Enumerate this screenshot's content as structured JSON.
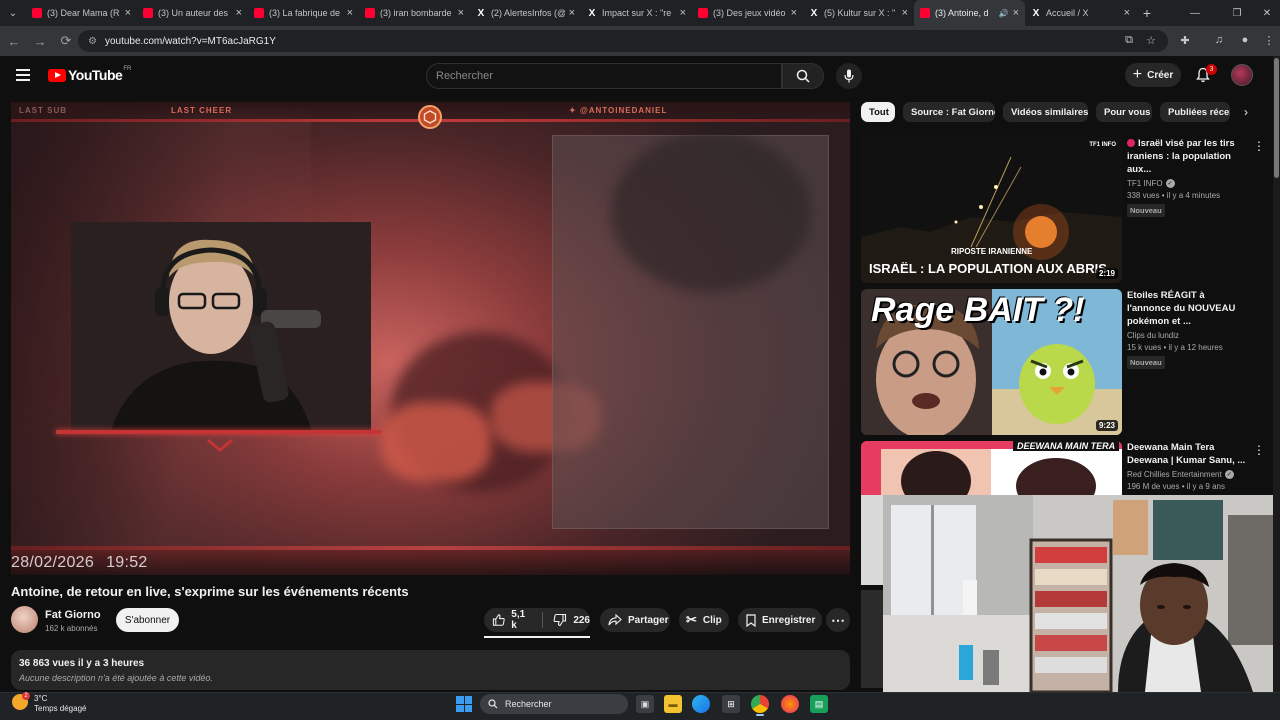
{
  "browser": {
    "tabs": [
      {
        "label": "(3) Dear Mama (R",
        "icon": "youtube-icon",
        "active": false
      },
      {
        "label": "(3) Un auteur des",
        "icon": "youtube-icon",
        "active": false
      },
      {
        "label": "(3) La fabrique de",
        "icon": "youtube-icon",
        "active": false
      },
      {
        "label": "(3) iran bombarde",
        "icon": "youtube-icon",
        "active": false
      },
      {
        "label": "(2) AlertesInfos (@",
        "icon": "x-icon",
        "active": false
      },
      {
        "label": "Impact sur X : \"re",
        "icon": "x-icon",
        "active": false
      },
      {
        "label": "(3) Des jeux vidéo",
        "icon": "youtube-icon",
        "active": false
      },
      {
        "label": "(5) Kultur sur X : \"",
        "icon": "x-icon",
        "active": false
      },
      {
        "label": "(3) Antoine, d",
        "icon": "youtube-icon",
        "active": true
      },
      {
        "label": "Accueil / X",
        "icon": "x-icon",
        "active": false
      }
    ],
    "url": "youtube.com/watch?v=MT6acJaRG1Y"
  },
  "header": {
    "logo_text": "YouTube",
    "country_code": "FR",
    "search_placeholder": "Rechercher",
    "create_label": "Créer",
    "notification_count": "3"
  },
  "player": {
    "overlay_last_sub": "LAST SUB",
    "overlay_last_cheer": "LAST CHEER",
    "overlay_handle": "@ANTOINEDANIEL",
    "date": "28/02/2026",
    "time": "19:52"
  },
  "video": {
    "title": "Antoine, de retour en live, s'exprime sur les événements récents",
    "channel_name": "Fat Giorno",
    "subscribers": "162 k abonnés",
    "subscribe_label": "S'abonner",
    "likes": "5,1 k",
    "dislikes": "226",
    "share_label": "Partager",
    "clip_label": "Clip",
    "save_label": "Enregistrer",
    "views_time": "36 863 vues  il y a 3 heures",
    "description": "Aucune description n'a été ajoutée à cette vidéo."
  },
  "chips": [
    {
      "label": "Tout",
      "active": true
    },
    {
      "label": "Source : Fat Giorno",
      "active": false
    },
    {
      "label": "Vidéos similaires",
      "active": false
    },
    {
      "label": "Pour vous",
      "active": false
    },
    {
      "label": "Publiées récemment",
      "active": false
    }
  ],
  "recommendations": [
    {
      "title": "Israël visé par les tirs iraniens : la population aux...",
      "channel": "TF1 INFO",
      "verified": true,
      "live_dot": true,
      "meta": "338 vues • il y a 4 minutes",
      "badge": "Nouveau",
      "duration": "2:19",
      "thumb_text": "ISRAËL : LA POPULATION AUX ABRIS",
      "thumb_caption": "RIPOSTE IRANIENNE",
      "thumb_brand": "TF1 INFO"
    },
    {
      "title": "Etoiles RÉAGIT à l'annonce du NOUVEAU pokémon et ...",
      "channel": "Clips du lundiz",
      "verified": false,
      "live_dot": false,
      "meta": "15 k vues • il y a 12 heures",
      "badge": "Nouveau",
      "duration": "9:23",
      "thumb_text": "Rage BAIT ?!"
    },
    {
      "title": "Deewana Main Tera Deewana | Kumar Sanu, ...",
      "channel": "Red Chillies Entertainment",
      "verified": true,
      "live_dot": false,
      "meta": "196 M de vues • il y a 9 ans",
      "badge": "",
      "duration": "",
      "thumb_text": "DEEWANA MAIN TERA"
    }
  ],
  "taskbar": {
    "temperature": "3°C",
    "weather": "Temps dégagé",
    "weather_badge": "2",
    "search_label": "Rechercher"
  },
  "colors": {
    "yt_red": "#ff0000",
    "background": "#0f0f0f",
    "chip_bg": "#272727"
  }
}
